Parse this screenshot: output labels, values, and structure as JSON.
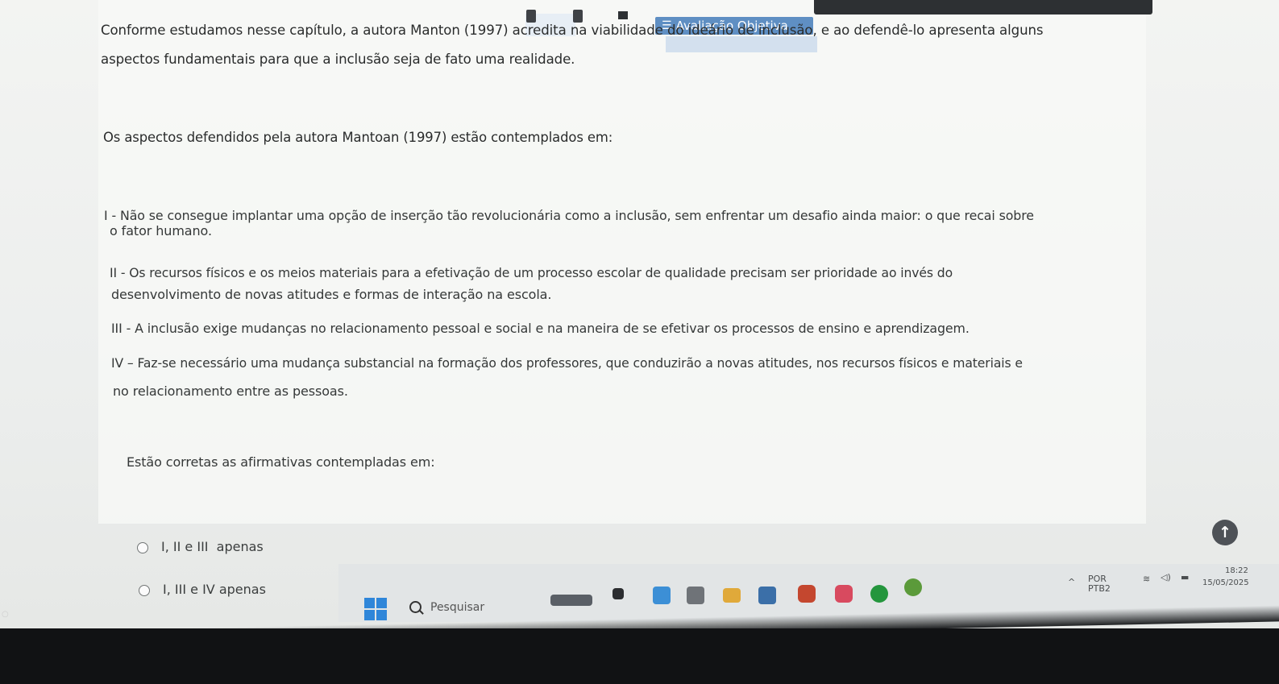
{
  "overlay": {
    "icon": "list-icon",
    "label": "Avaliação Objetiva"
  },
  "question": {
    "intro_line1": "Conforme estudamos nesse capítulo, a autora Manton (1997) acredita na viabilidade do ideário de inclusão, e ao defendê-lo apresenta alguns",
    "intro_line2": "aspectos fundamentais para que a inclusão seja de fato uma realidade.",
    "prompt": "Os aspectos defendidos pela autora Mantoan (1997) estão contemplados em:",
    "statements": [
      {
        "line1": "I - Não se consegue implantar uma opção de inserção tão revolucionária como a inclusão, sem enfrentar um desafio ainda maior: o que recai sobre",
        "line2": "o fator humano."
      },
      {
        "line1": "II - Os recursos físicos e os meios materiais para a efetivação de um processo escolar de qualidade precisam ser prioridade ao invés do",
        "line2": "desenvolvimento de novas atitudes e formas de interação na escola."
      },
      {
        "line1": "III - A inclusão exige mudanças no relacionamento pessoal e social e na maneira de se efetivar os processos de ensino e aprendizagem.",
        "line2": ""
      },
      {
        "line1": "IV – Faz-se necessário uma mudança substancial na formação dos professores, que conduzirão a novas atitudes, nos recursos físicos e materiais e",
        "line2": "no relacionamento entre as pessoas."
      }
    ],
    "instruction": "Estão corretas as afirmativas contempladas em:",
    "options": [
      "I, II e III  apenas",
      "I, III e IV apenas"
    ]
  },
  "taskbar": {
    "search_placeholder": "Pesquisar",
    "tray_lang": "POR",
    "tray_layout": "PTB2",
    "time": "18:22",
    "date": "15/05/2025"
  },
  "colors": {
    "accent": "#5f8fc3",
    "windows_blue": "#2f86d9"
  }
}
